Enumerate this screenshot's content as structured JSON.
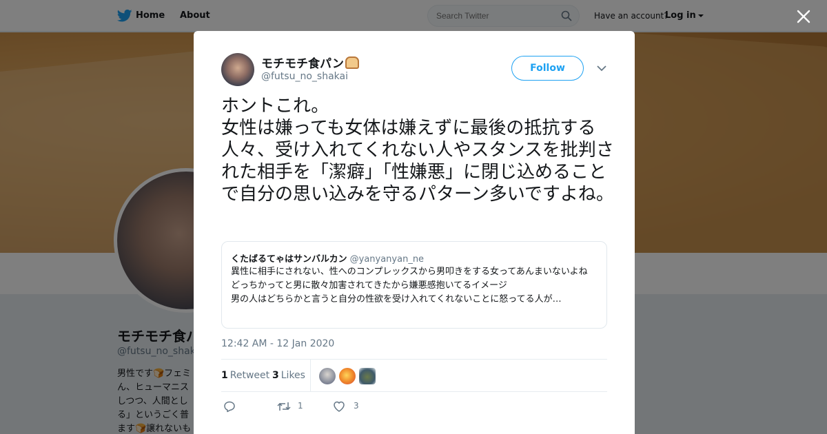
{
  "nav": {
    "home": "Home",
    "about": "About",
    "search_placeholder": "Search Twitter",
    "have_account": "Have an account?",
    "login": "Log in"
  },
  "profile": {
    "name": "モチモチ食パン",
    "handle": "@futsu_no_shakai",
    "bio": "男性です🍞フェミ\nん、ヒューマニス\nしつつ、人間とし\nる」というごく普\nます🍞譲れないも"
  },
  "tweet": {
    "author_name": "モチモチ食パン",
    "author_handle": "@futsu_no_shakai",
    "follow_label": "Follow",
    "text": "ホントこれ。\n女性は嫌っても女体は嫌えずに最後の抵抗する人々、受け入れてくれない人やスタンスを批判された相手を「潔癖」「性嫌悪」に閉じ込めることで自分の思い込みを守るパターン多いですよね。",
    "timestamp": "12:42 AM - 12 Jan 2020",
    "retweets": "1",
    "retweets_label": "Retweet",
    "likes": "3",
    "likes_label": "Likes",
    "retweet_action_count": "1",
    "like_action_count": "3"
  },
  "quote": {
    "name": "くたばるてゃはサンバルカン",
    "handle": "@yanyanyan_ne",
    "text": "異性に相手にされない、性へのコンプレックスから男叩きをする女ってあんまいないよね\nどっちかってと男に散々加害されてきたから嫌悪感抱いてるイメージ\n男の人はどちらかと言うと自分の性欲を受け入れてくれないことに怒ってる人が…"
  },
  "colors": {
    "accent": "#1da1f2",
    "secondary_text": "#657786",
    "border": "#e6ecf0"
  },
  "icons": [
    "twitter-bird-icon",
    "search-icon",
    "close-icon",
    "chevron-down-icon",
    "reply-icon",
    "retweet-icon",
    "heart-icon",
    "bread-emoji-icon"
  ]
}
